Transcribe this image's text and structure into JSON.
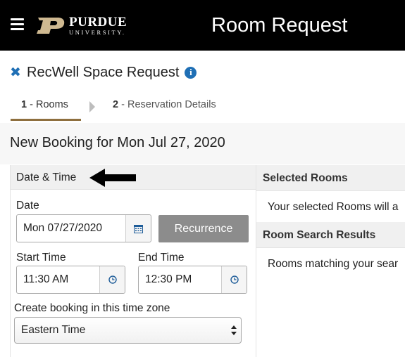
{
  "header": {
    "logo_name": "PURDUE",
    "logo_sub": "UNIVERSITY.",
    "app_title": "Room Request"
  },
  "request": {
    "title": "RecWell Space Request"
  },
  "steps": [
    {
      "number": "1",
      "separator": " - ",
      "label": "Rooms",
      "active": true
    },
    {
      "number": "2",
      "separator": " - ",
      "label": "Reservation Details",
      "active": false
    }
  ],
  "booking": {
    "title": "New Booking for Mon Jul 27, 2020"
  },
  "date_time": {
    "heading": "Date & Time",
    "date_label": "Date",
    "date_value": "Mon 07/27/2020",
    "recurrence_label": "Recurrence",
    "start_label": "Start Time",
    "start_value": "11:30 AM",
    "end_label": "End Time",
    "end_value": "12:30 PM",
    "timezone_label": "Create booking in this time zone",
    "timezone_value": "Eastern Time"
  },
  "selected_rooms": {
    "heading": "Selected Rooms",
    "message": "Your selected Rooms will a"
  },
  "search_results": {
    "heading": "Room Search Results",
    "message": "Rooms matching your sear"
  },
  "colors": {
    "topbar": "#000000",
    "accent_blue": "#1f6fb5",
    "gold_underline": "#8e6f3e",
    "recurrence_button": "#8c8c8c"
  }
}
